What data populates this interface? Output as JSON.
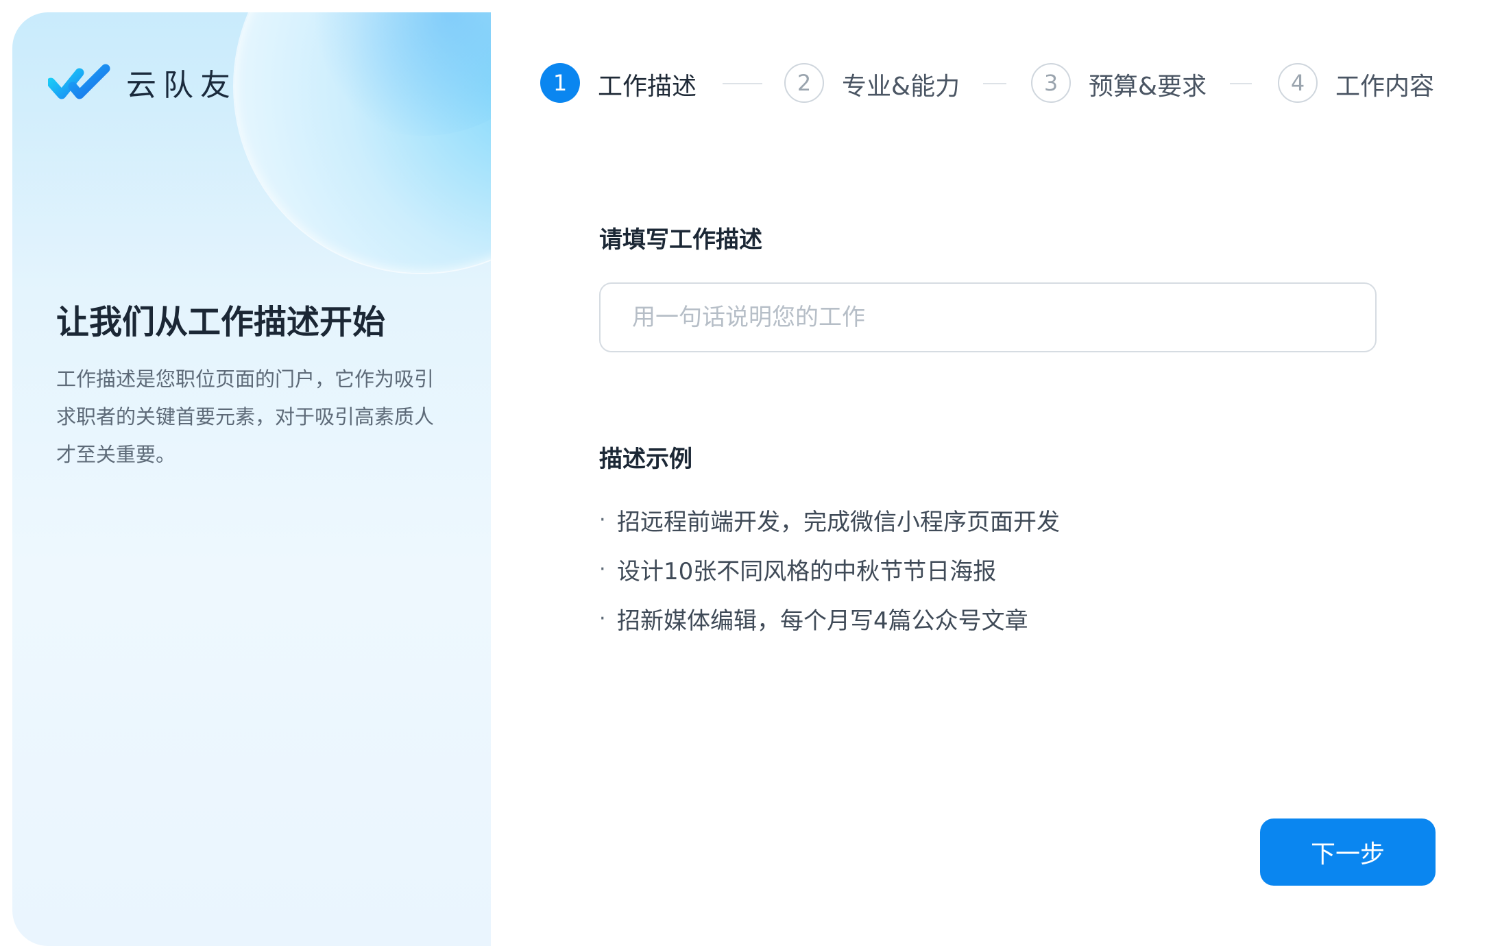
{
  "brand": {
    "name": "云队友",
    "logo_icon": "double-check-icon",
    "colors": {
      "primary": "#0a86f0",
      "logo_blue": "#1a8af5",
      "logo_cyan": "#19d0f5"
    }
  },
  "sidebar": {
    "title": "让我们从工作描述开始",
    "description": "工作描述是您职位页面的门户，它作为吸引求职者的关键首要元素，对于吸引高素质人才至关重要。"
  },
  "steps": {
    "current": 1,
    "items": [
      {
        "number": "1",
        "label": "工作描述",
        "state": "active"
      },
      {
        "number": "2",
        "label": "专业&能力",
        "state": "inactive"
      },
      {
        "number": "3",
        "label": "预算&要求",
        "state": "inactive"
      },
      {
        "number": "4",
        "label": "工作内容",
        "state": "inactive"
      }
    ]
  },
  "form": {
    "label": "请填写工作描述",
    "value": "",
    "placeholder": "用一句话说明您的工作"
  },
  "examples": {
    "title": "描述示例",
    "bullet": "·",
    "items": [
      "招远程前端开发，完成微信小程序页面开发",
      "设计10张不同风格的中秋节节日海报",
      "招新媒体编辑，每个月写4篇公众号文章"
    ]
  },
  "actions": {
    "next_label": "下一步"
  }
}
